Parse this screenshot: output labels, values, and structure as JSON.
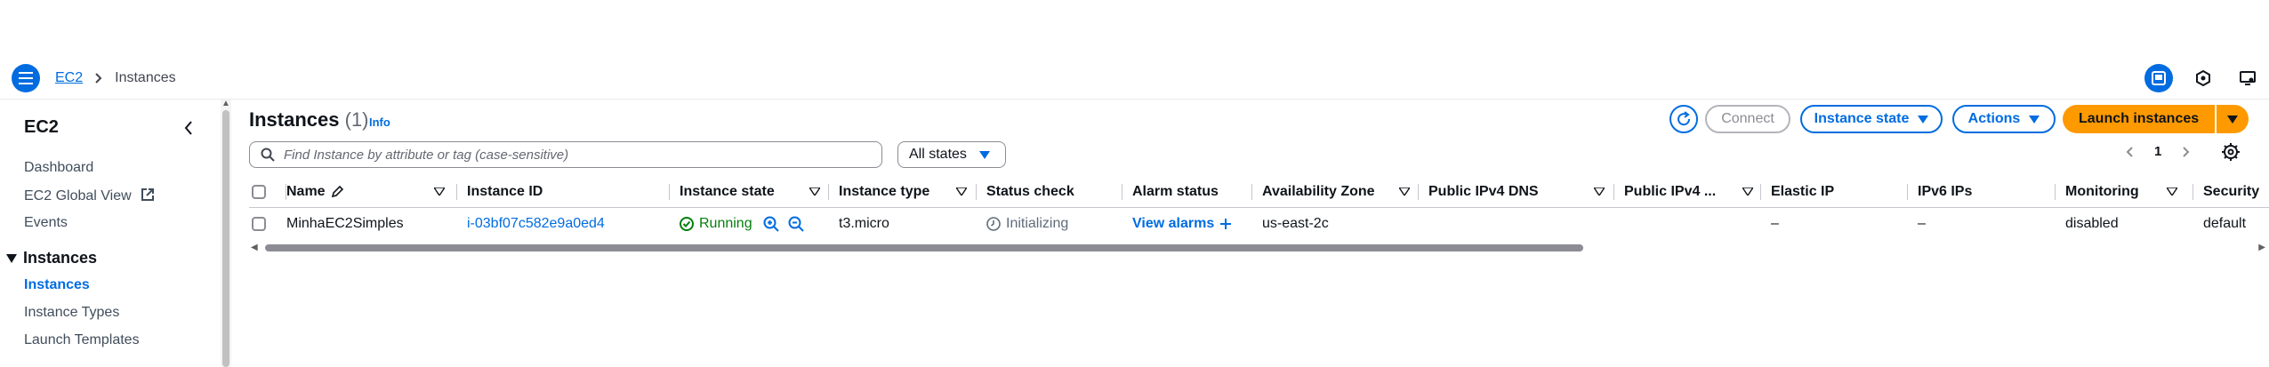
{
  "breadcrumb": {
    "service": "EC2",
    "current": "Instances"
  },
  "sidebar": {
    "title": "EC2",
    "links": [
      "Dashboard",
      "EC2 Global View",
      "Events"
    ],
    "section": "Instances",
    "section_items": [
      "Instances",
      "Instance Types",
      "Launch Templates"
    ]
  },
  "header": {
    "title": "Instances",
    "count": "(1)",
    "info": "Info",
    "connect_label": "Connect",
    "instance_state_label": "Instance state",
    "actions_label": "Actions",
    "launch_label": "Launch instances"
  },
  "search": {
    "placeholder": "Find Instance by attribute or tag (case-sensitive)",
    "value": ""
  },
  "filter": {
    "label": "All states"
  },
  "pagination": {
    "page": "1"
  },
  "table": {
    "columns": [
      "Name",
      "Instance ID",
      "Instance state",
      "Instance type",
      "Status check",
      "Alarm status",
      "Availability Zone",
      "Public IPv4 DNS",
      "Public IPv4 ...",
      "Elastic IP",
      "IPv6 IPs",
      "Monitoring",
      "Security"
    ],
    "rows": [
      {
        "name": "MinhaEC2Simples",
        "instance_id": "i-03bf07c582e9a0ed4",
        "state": "Running",
        "type": "t3.micro",
        "status_check": "Initializing",
        "alarm_status": "View alarms",
        "az": "us-east-2c",
        "public_dns": "",
        "public_ip": "",
        "elastic_ip": "–",
        "ipv6": "–",
        "monitoring": "disabled",
        "security": "default"
      }
    ]
  },
  "colors": {
    "accent": "#006ce0",
    "launch": "#ff9900",
    "running": "#037f0c"
  }
}
